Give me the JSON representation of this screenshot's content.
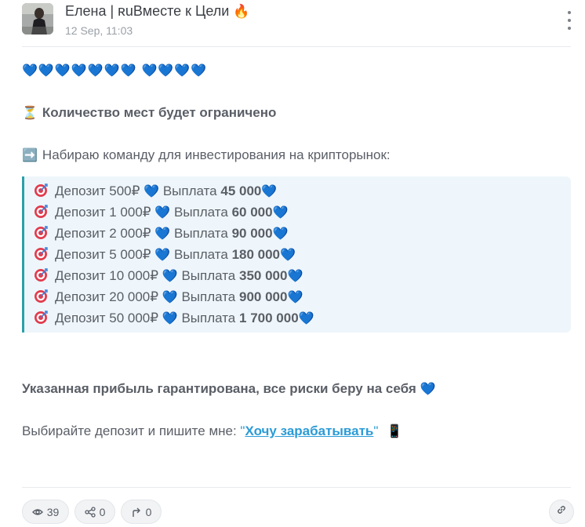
{
  "post": {
    "author": "Елена | ʀuВместе к Цели",
    "author_emoji": "🔥",
    "date": "12 Sep, 11:03"
  },
  "content": {
    "hearts_line": [
      "💙",
      "💙",
      "💙",
      "💙",
      "💙",
      "💙",
      "💙",
      "💙",
      "💙",
      "💙",
      "💙"
    ],
    "limited_icon": "⏳",
    "limited_text": "Количество мест будет ограничено",
    "recruit_icon": "➡️",
    "recruit_text": "Набираю команду для инвестирования на крипторынок:",
    "deposits": [
      {
        "deposit": "Депозит 500₽",
        "payout_label": "Выплата",
        "payout": "45 000"
      },
      {
        "deposit": "Депозит 1 000₽",
        "payout_label": "Выплата",
        "payout": "60 000"
      },
      {
        "deposit": "Депозит 2 000₽",
        "payout_label": "Выплата",
        "payout": "90 000"
      },
      {
        "deposit": "Депозит 5 000₽",
        "payout_label": "Выплата",
        "payout": "180 000"
      },
      {
        "deposit": "Депозит 10 000₽",
        "payout_label": "Выплата",
        "payout": "350 000"
      },
      {
        "deposit": "Депозит 20 000₽",
        "payout_label": "Выплата",
        "payout": "900 000"
      },
      {
        "deposit": "Депозит 50 000₽",
        "payout_label": "Выплата",
        "payout": "1 700 000"
      }
    ],
    "heart": "💙",
    "guarantee_text": "Указанная прибыль гарантирована, все риски беру на себя",
    "cta_text": "Выбирайте депозит и пишите мне: ",
    "cta_quote_open": "\"",
    "cta_link": "Хочу зарабатывать",
    "cta_quote_close": "\"",
    "cta_icon": "📱"
  },
  "footer": {
    "views": "39",
    "shares": "0",
    "forwards": "0",
    "icons": [
      "eye-icon",
      "share-icon",
      "forward-icon",
      "link-icon"
    ]
  },
  "colors": {
    "accent": "#2b9bd6",
    "quote_border": "#2aa0a8",
    "quote_bg": "#eef6fb",
    "heart": "#3a6fe0"
  }
}
